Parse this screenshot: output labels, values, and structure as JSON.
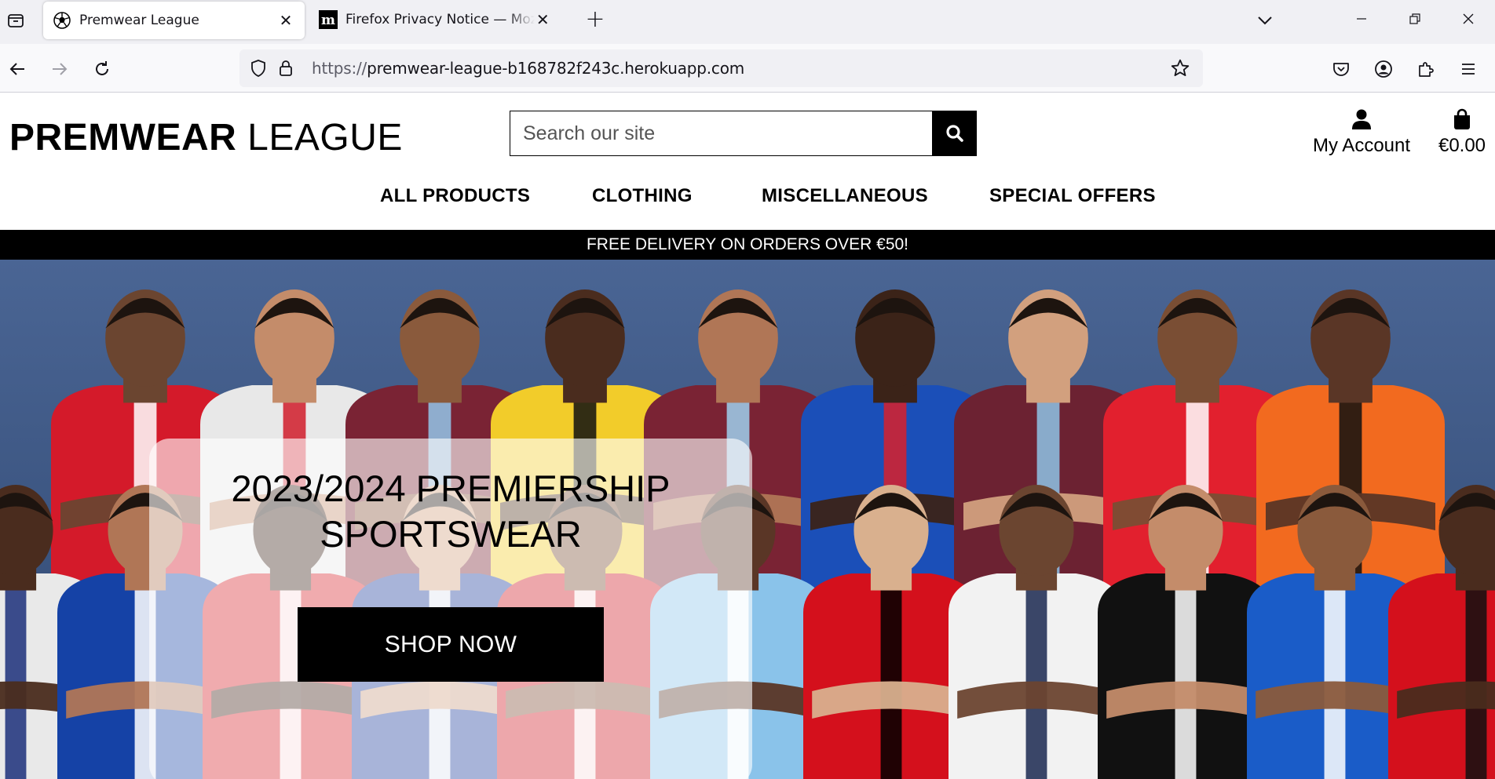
{
  "browser": {
    "tabs": [
      {
        "title": "Premwear League",
        "active": true,
        "favicon": "football-icon"
      },
      {
        "title": "Firefox Privacy Notice — Mozilla",
        "active": false,
        "favicon": "mozilla-m-icon"
      }
    ],
    "url_protocol": "https://",
    "url_host": "premwear-league-b168782f243c.herokuapp.com"
  },
  "site": {
    "logo_bold": "PREMWEAR",
    "logo_light": "LEAGUE",
    "search_placeholder": "Search our site",
    "account_label": "My Account",
    "bag_total": "€0.00",
    "nav": [
      {
        "label": "ALL PRODUCTS"
      },
      {
        "label": "CLOTHING"
      },
      {
        "label": "MISCELLANEOUS"
      },
      {
        "label": "SPECIAL OFFERS"
      }
    ],
    "delivery_banner": "FREE DELIVERY ON ORDERS OVER €50!",
    "hero": {
      "title_line1": "2023/2024 PREMIERSHIP",
      "title_line2": "SPORTSWEAR",
      "cta": "SHOP NOW"
    }
  },
  "colors": {
    "hero_background": "#3f5a87",
    "banner_background": "#000000",
    "tabbar": "#f0f0f4"
  }
}
